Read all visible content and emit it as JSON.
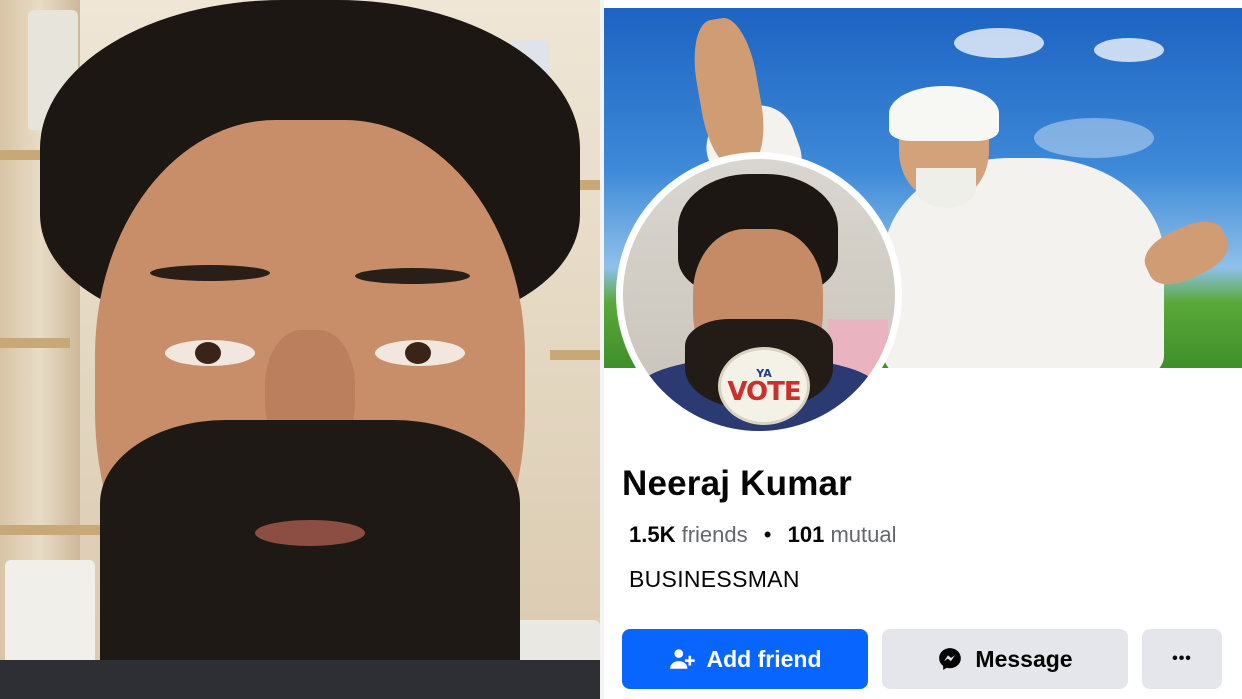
{
  "profile": {
    "name": "Neeraj Kumar",
    "friends_count": "1.5K",
    "friends_label": "friends",
    "separator": "•",
    "mutual_count": "101",
    "mutual_label": "mutual",
    "bio": "BUSINESSMAN"
  },
  "avatar_badge": {
    "small_text": "YA",
    "big_text": "VOTE"
  },
  "actions": {
    "add_friend_label": "Add friend",
    "message_label": "Message",
    "more_label": "•••"
  },
  "icons": {
    "add_friend": "add-person-icon",
    "message": "messenger-icon",
    "more": "more-dots-icon"
  },
  "colors": {
    "primary_button": "#0866ff",
    "secondary_button": "#e4e6eb",
    "text_primary": "#050505",
    "text_secondary": "#65676b"
  }
}
